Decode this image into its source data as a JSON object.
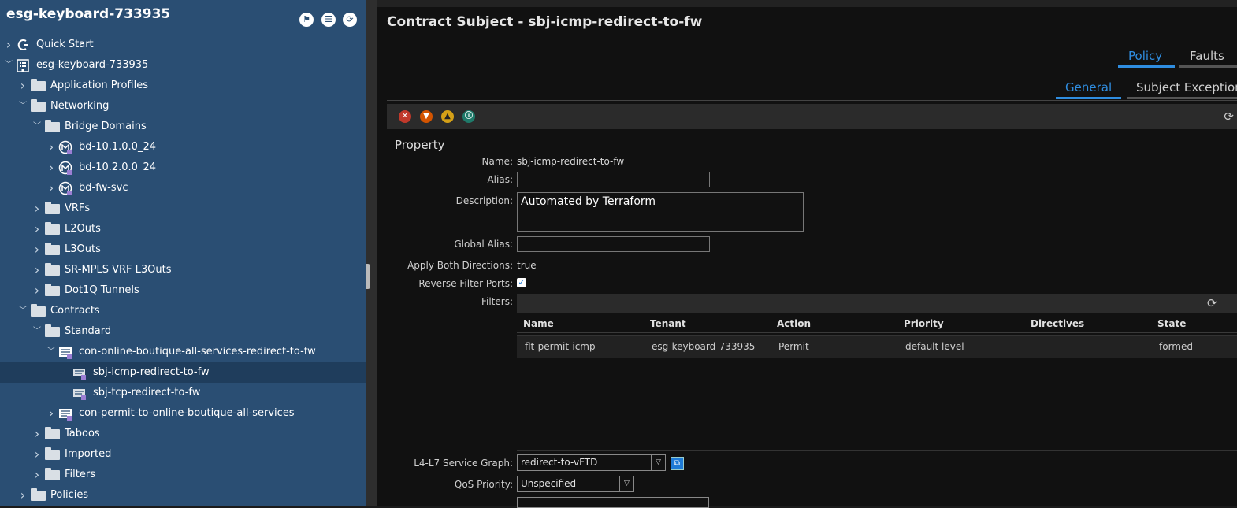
{
  "left_panel": {
    "title": "esg-keyboard-733935",
    "tree": [
      {
        "label": "Quick Start",
        "icon": "quick-start-icon",
        "chevron": "right"
      },
      {
        "label": "esg-keyboard-733935",
        "icon": "tenant-building-icon",
        "chevron": "down"
      },
      {
        "label": "Application Profiles",
        "icon": "folder-icon",
        "chevron": "right"
      },
      {
        "label": "Networking",
        "icon": "folder-icon",
        "chevron": "down"
      },
      {
        "label": "Bridge Domains",
        "icon": "folder-icon",
        "chevron": "down"
      },
      {
        "label": "bd-10.1.0.0_24",
        "icon": "bridge-domain-icon",
        "chevron": "right"
      },
      {
        "label": "bd-10.2.0.0_24",
        "icon": "bridge-domain-icon",
        "chevron": "right"
      },
      {
        "label": "bd-fw-svc",
        "icon": "bridge-domain-icon",
        "chevron": "right"
      },
      {
        "label": "VRFs",
        "icon": "folder-icon",
        "chevron": "right"
      },
      {
        "label": "L2Outs",
        "icon": "folder-icon",
        "chevron": "right"
      },
      {
        "label": "L3Outs",
        "icon": "folder-icon",
        "chevron": "right"
      },
      {
        "label": "SR-MPLS VRF L3Outs",
        "icon": "folder-icon",
        "chevron": "right"
      },
      {
        "label": "Dot1Q Tunnels",
        "icon": "folder-icon",
        "chevron": "right"
      },
      {
        "label": "Contracts",
        "icon": "folder-icon",
        "chevron": "down"
      },
      {
        "label": "Standard",
        "icon": "folder-icon",
        "chevron": "down"
      },
      {
        "label": "con-online-boutique-all-services-redirect-to-fw",
        "icon": "contract-icon",
        "chevron": "down"
      },
      {
        "label": "sbj-icmp-redirect-to-fw",
        "icon": "subject-icon",
        "chevron": "none"
      },
      {
        "label": "sbj-tcp-redirect-to-fw",
        "icon": "subject-icon",
        "chevron": "none"
      },
      {
        "label": "con-permit-to-online-boutique-all-services",
        "icon": "contract-icon",
        "chevron": "right"
      },
      {
        "label": "Taboos",
        "icon": "folder-icon",
        "chevron": "right"
      },
      {
        "label": "Imported",
        "icon": "folder-icon",
        "chevron": "right"
      },
      {
        "label": "Filters",
        "icon": "folder-icon",
        "chevron": "right"
      },
      {
        "label": "Policies",
        "icon": "folder-icon",
        "chevron": "right"
      }
    ]
  },
  "main": {
    "title": "Contract Subject - sbj-icmp-redirect-to-fw",
    "tabs": [
      "Policy",
      "Faults"
    ],
    "subtabs": [
      "General",
      "Subject Exception"
    ],
    "property_heading": "Property",
    "fields": {
      "name_label": "Name:",
      "name_value": "sbj-icmp-redirect-to-fw",
      "alias_label": "Alias:",
      "alias_value": "",
      "description_label": "Description:",
      "description_value": "Automated by Terraform",
      "global_alias_label": "Global Alias:",
      "global_alias_value": "",
      "apply_both_label": "Apply Both Directions:",
      "apply_both_value": "true",
      "reverse_ports_label": "Reverse Filter Ports:",
      "filters_label": "Filters:",
      "service_graph_label": "L4-L7 Service Graph:",
      "service_graph_value": "redirect-to-vFTD",
      "qos_label": "QoS Priority:",
      "qos_value": "Unspecified"
    },
    "filters_table": {
      "columns": [
        "Name",
        "Tenant",
        "Action",
        "Priority",
        "Directives",
        "State"
      ],
      "rows": [
        [
          "flt-permit-icmp",
          "esg-keyboard-733935",
          "Permit",
          "default level",
          "",
          "formed"
        ]
      ]
    },
    "colors": {
      "accent": "#2f8de0",
      "left_panel": "#2a4e73"
    }
  }
}
